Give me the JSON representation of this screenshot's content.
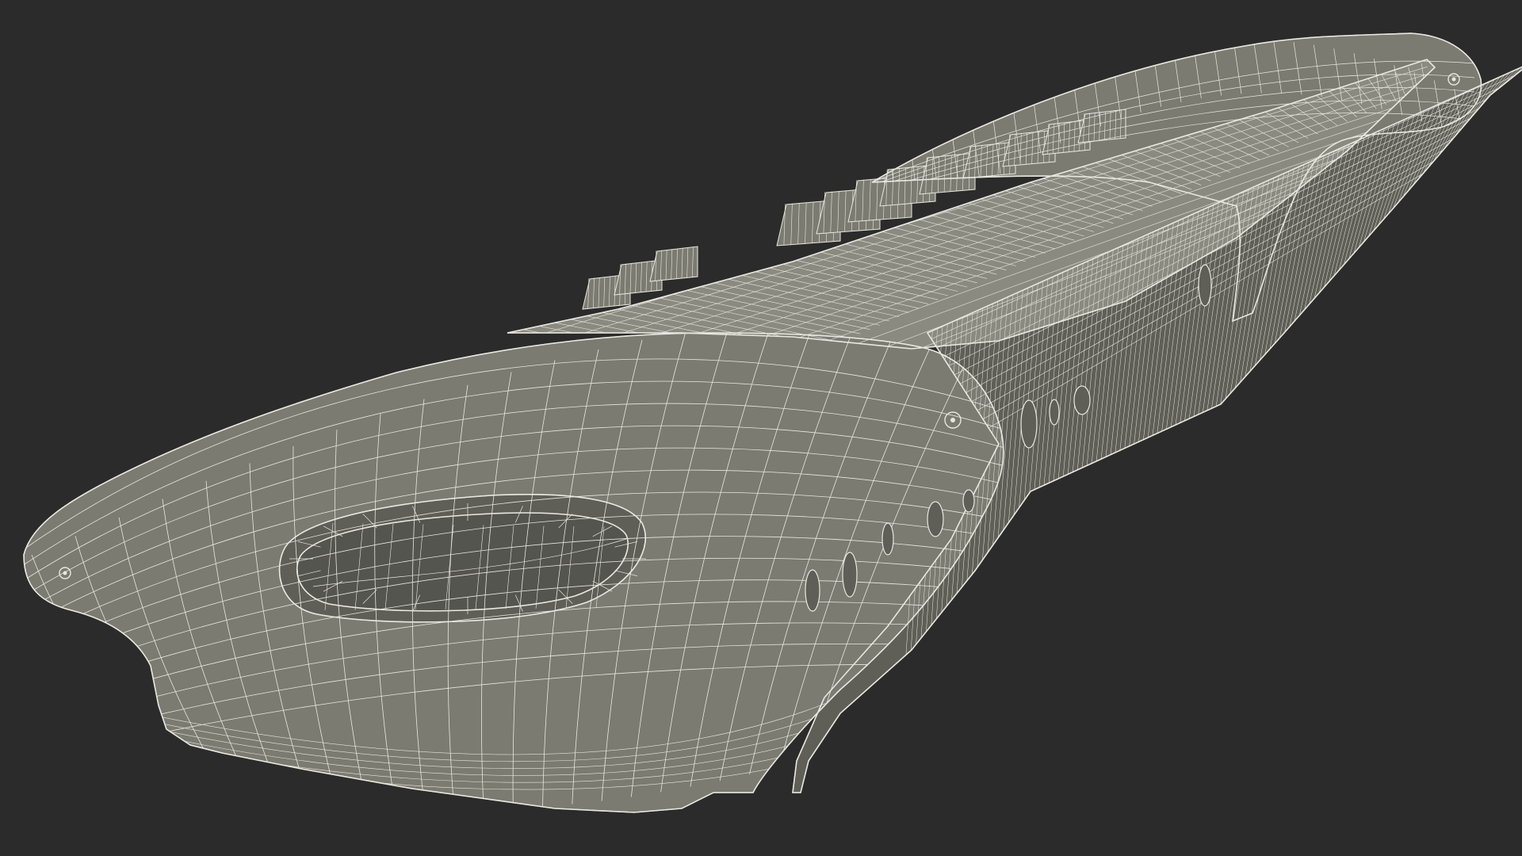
{
  "scene": {
    "background_color": "#2b2b2b",
    "model_color": "#7b7b72",
    "model_color_dark": "#5f5f58",
    "model_color_light": "#8a8a80",
    "wire_color": "#e8e8e0",
    "render_mode": "wireframe-on-shaded",
    "subject": "keyboard-instrument-body-3d-model"
  }
}
